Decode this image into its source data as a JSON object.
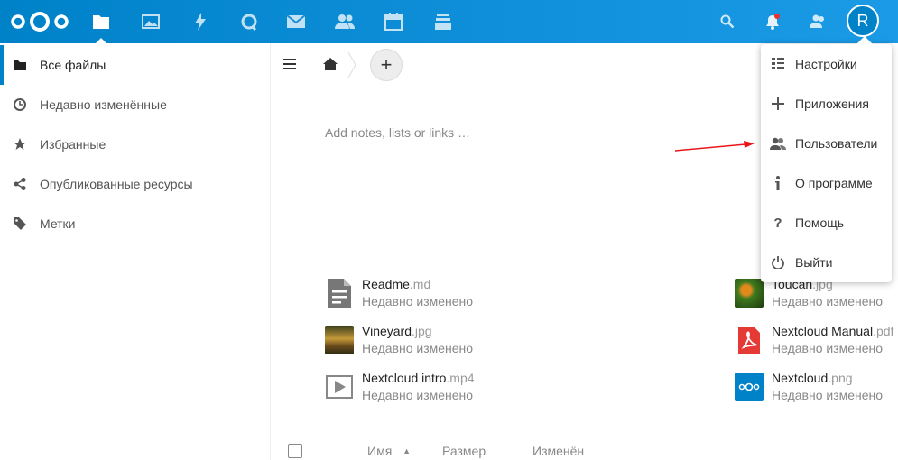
{
  "header": {
    "logo_icon": "nextcloud-logo",
    "apps": [
      {
        "name": "files",
        "icon": "folder-icon"
      },
      {
        "name": "photos",
        "icon": "image-icon"
      },
      {
        "name": "activity",
        "icon": "lightning-icon"
      },
      {
        "name": "talk",
        "icon": "talk-icon"
      },
      {
        "name": "mail",
        "icon": "mail-icon"
      },
      {
        "name": "contacts",
        "icon": "contacts-icon"
      },
      {
        "name": "calendar",
        "icon": "calendar-icon"
      },
      {
        "name": "deck",
        "icon": "deck-icon"
      }
    ],
    "avatar_letter": "R",
    "accent": "#0082c9"
  },
  "sidebar": {
    "items": [
      {
        "label": "Все файлы",
        "icon": "folder-icon"
      },
      {
        "label": "Недавно изменённые",
        "icon": "clock-icon"
      },
      {
        "label": "Избранные",
        "icon": "star-icon"
      },
      {
        "label": "Опубликованные ресурсы",
        "icon": "share-icon"
      },
      {
        "label": "Метки",
        "icon": "tag-icon"
      }
    ]
  },
  "main": {
    "add_label": "+",
    "notes_placeholder": "Add notes, lists or links …",
    "recent": [
      {
        "name": "Readme",
        "ext": ".md",
        "sub": "Недавно изменено"
      },
      {
        "name": "Vineyard",
        "ext": ".jpg",
        "sub": "Недавно изменено"
      },
      {
        "name": "Nextcloud intro",
        "ext": ".mp4",
        "sub": "Недавно изменено"
      },
      {
        "name": "Toucan",
        "ext": ".jpg",
        "sub": "Недавно изменено"
      },
      {
        "name": "Nextcloud Manual",
        "ext": ".pdf",
        "sub": "Недавно изменено"
      },
      {
        "name": "Nextcloud",
        "ext": ".png",
        "sub": "Недавно изменено"
      }
    ],
    "columns": {
      "name": "Имя",
      "sort_indicator": "▲",
      "size": "Размер",
      "modified": "Изменён"
    }
  },
  "menu": {
    "items": [
      {
        "label": "Настройки",
        "icon": "settings-list-icon"
      },
      {
        "label": "Приложения",
        "icon": "plus-icon"
      },
      {
        "label": "Пользователи",
        "icon": "users-icon"
      },
      {
        "label": "О программе",
        "icon": "info-icon"
      },
      {
        "label": "Помощь",
        "icon": "help-icon"
      },
      {
        "label": "Выйти",
        "icon": "power-icon"
      }
    ]
  }
}
